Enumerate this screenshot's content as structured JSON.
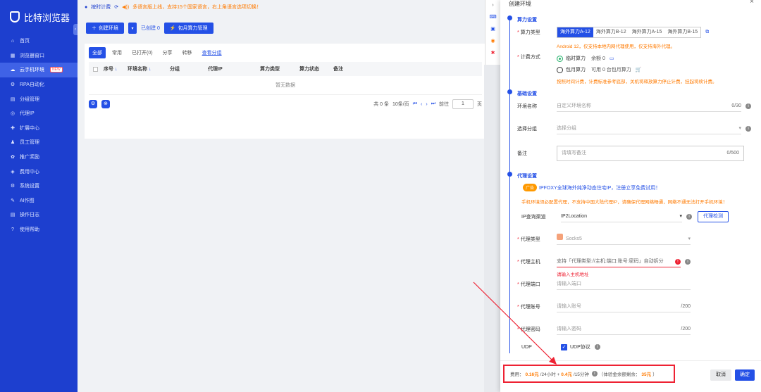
{
  "app": {
    "name": "比特浏览器"
  },
  "sidebar": {
    "items": [
      {
        "label": "首页",
        "icon": "home-icon"
      },
      {
        "label": "浏览器窗口",
        "icon": "grid-icon"
      },
      {
        "label": "云手机环境",
        "icon": "cloud-icon",
        "badge": "NEW",
        "active": true
      },
      {
        "label": "RPA自动化",
        "icon": "gear-icon"
      },
      {
        "label": "分组管理",
        "icon": "folder-icon"
      },
      {
        "label": "代理IP",
        "icon": "location-icon"
      },
      {
        "label": "扩展中心",
        "icon": "puzzle-icon"
      },
      {
        "label": "员工管理",
        "icon": "users-icon"
      },
      {
        "label": "推广奖励",
        "icon": "gift-icon"
      },
      {
        "label": "费用中心",
        "icon": "wallet-icon"
      },
      {
        "label": "系统设置",
        "icon": "settings-icon"
      },
      {
        "label": "AI作图",
        "icon": "ai-icon"
      },
      {
        "label": "操作日志",
        "icon": "log-icon"
      },
      {
        "label": "使用帮助",
        "icon": "help-icon"
      }
    ]
  },
  "topbar": {
    "billing": "按时计费",
    "notice": "多语言版上线，支持15个国家语言，右上角语言选项切换！"
  },
  "toolbar": {
    "create_label": "创建环境",
    "created_label": "已创建 0",
    "monthly_label": "包月算力管理"
  },
  "table": {
    "tabs": [
      "全部",
      "常用",
      "已打开(0)",
      "分享",
      "转移",
      "查看分组"
    ],
    "columns": [
      "序号",
      "环境名称",
      "分组",
      "代理IP",
      "算力类型",
      "算力状态",
      "备注"
    ],
    "empty": "暂无数据",
    "pager": {
      "total": "共 0 条",
      "per_page": "10条/页",
      "goto": "前往",
      "page": "1",
      "unit": "页"
    }
  },
  "panel": {
    "title": "创建环境",
    "sections": {
      "compute": "算力设置",
      "basic": "基础设置",
      "proxy": "代理设置"
    },
    "compute": {
      "type_label": "算力类型",
      "types": [
        "海外算力A-12",
        "海外算力B-12",
        "海外算力A-15",
        "海外算力B-15"
      ],
      "android_tip": "Android 12，仅支持本地内网代理使用，仅支持海外代理。",
      "billing_label": "计费方式",
      "hourly": "临时算力",
      "hourly_remain": "余额 0",
      "monthly": "包月算力",
      "monthly_avail": "可用 0 台包月算力",
      "billing_tip": "按照时间计费，计费标准参考底部，关机将释放算力停止计费，挂起将续计费。"
    },
    "basic": {
      "name_label": "环境名称",
      "name_placeholder": "自定义环境名称",
      "name_count": "0/30",
      "group_label": "选择分组",
      "group_placeholder": "选择分组",
      "remark_label": "备注",
      "remark_placeholder": "请填写备注",
      "remark_count": "0/500"
    },
    "proxy": {
      "ad_badge": "广告",
      "ad_text": "IPFOXY全球海外纯净动态住宅IP，注册立享免费试用！",
      "warn": "手机环境须必配置代理，不支持中国大陆代理IP，请确保代理网络畅通，网络不通无法打开手机环境！",
      "channel_label": "IP查询渠道",
      "channel_value": "IP2Location",
      "detect_btn": "代理检测",
      "type_label": "代理类型",
      "type_value": "Socks5",
      "host_label": "代理主机",
      "host_placeholder": "支持「代理类型://主机:端口:账号:密码」自动拆分",
      "host_error": "请输入主机地址",
      "port_label": "代理端口",
      "port_placeholder": "请输入端口",
      "account_label": "代理账号",
      "account_placeholder": "请输入账号",
      "account_count": "/200",
      "password_label": "代理密码",
      "password_placeholder": "请输入密码",
      "password_count": "/200",
      "udp_label": "UDP",
      "udp_check": "UDP协议"
    },
    "footer": {
      "fee_label": "费用：",
      "fee_day": "0.16元",
      "fee_day_unit": "/24小时 +",
      "fee_min": "0.4元",
      "fee_min_unit": "/15分钟",
      "trial_text": "（体验金余额剩余：",
      "trial_amount": "35元",
      "trial_end": "）",
      "cancel": "取消",
      "confirm": "确定"
    }
  },
  "colors": {
    "brand": "#1d3fcf",
    "accent": "#2450e6",
    "warning": "#ff7a00",
    "error": "#e23"
  }
}
